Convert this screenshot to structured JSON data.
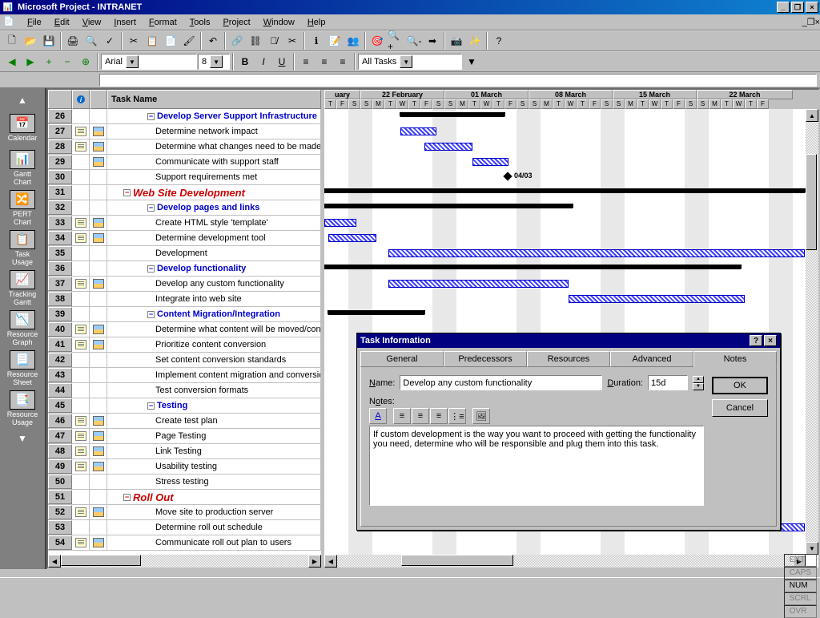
{
  "titlebar": {
    "app": "Microsoft Project",
    "doc": "INTRANET"
  },
  "menu": [
    "File",
    "Edit",
    "View",
    "Insert",
    "Format",
    "Tools",
    "Project",
    "Window",
    "Help"
  ],
  "toolbar2": {
    "font": "Arial",
    "size": "8",
    "filter": "All Tasks"
  },
  "viewbar": [
    {
      "label": "Calendar"
    },
    {
      "label": "Gantt Chart"
    },
    {
      "label": "PERT Chart"
    },
    {
      "label": "Task Usage"
    },
    {
      "label": "Tracking Gantt"
    },
    {
      "label": "Resource Graph"
    },
    {
      "label": "Resource Sheet"
    },
    {
      "label": "Resource Usage"
    }
  ],
  "grid": {
    "header": {
      "info": "i",
      "name": "Task Name"
    },
    "rows": [
      {
        "n": 26,
        "note": false,
        "ind": false,
        "lvl": 3,
        "bold": true,
        "text": "Develop Server Support Infrastructure",
        "out": "-"
      },
      {
        "n": 27,
        "note": true,
        "ind": true,
        "lvl": 4,
        "text": "Determine network impact"
      },
      {
        "n": 28,
        "note": true,
        "ind": true,
        "lvl": 4,
        "text": "Determine what changes need to be made"
      },
      {
        "n": 29,
        "note": false,
        "ind": true,
        "lvl": 4,
        "text": "Communicate with support staff"
      },
      {
        "n": 30,
        "note": false,
        "ind": false,
        "lvl": 4,
        "text": "Support requirements met"
      },
      {
        "n": 31,
        "note": false,
        "ind": false,
        "lvl": 2,
        "red": true,
        "text": "Web Site Development",
        "out": "-"
      },
      {
        "n": 32,
        "note": false,
        "ind": false,
        "lvl": 3,
        "bold": true,
        "text": "Develop pages and links",
        "out": "-"
      },
      {
        "n": 33,
        "note": true,
        "ind": true,
        "lvl": 4,
        "text": "Create HTML style 'template'"
      },
      {
        "n": 34,
        "note": true,
        "ind": true,
        "lvl": 4,
        "text": "Determine development tool"
      },
      {
        "n": 35,
        "note": false,
        "ind": false,
        "lvl": 4,
        "text": "Development"
      },
      {
        "n": 36,
        "note": false,
        "ind": false,
        "lvl": 3,
        "bold": true,
        "text": "Develop functionality",
        "out": "-"
      },
      {
        "n": 37,
        "note": true,
        "ind": true,
        "lvl": 4,
        "text": "Develop any custom functionality"
      },
      {
        "n": 38,
        "note": false,
        "ind": false,
        "lvl": 4,
        "text": "Integrate into web site"
      },
      {
        "n": 39,
        "note": false,
        "ind": false,
        "lvl": 3,
        "bold": true,
        "text": "Content Migration/Integration",
        "out": "-"
      },
      {
        "n": 40,
        "note": true,
        "ind": true,
        "lvl": 4,
        "text": "Determine what content will be moved/converted"
      },
      {
        "n": 41,
        "note": true,
        "ind": true,
        "lvl": 4,
        "text": "Prioritize content conversion"
      },
      {
        "n": 42,
        "note": false,
        "ind": false,
        "lvl": 4,
        "text": "Set content conversion standards"
      },
      {
        "n": 43,
        "note": false,
        "ind": false,
        "lvl": 4,
        "text": "Implement content migration and conversion"
      },
      {
        "n": 44,
        "note": false,
        "ind": false,
        "lvl": 4,
        "text": "Test conversion formats"
      },
      {
        "n": 45,
        "note": false,
        "ind": false,
        "lvl": 3,
        "bold": true,
        "text": "Testing",
        "out": "-"
      },
      {
        "n": 46,
        "note": true,
        "ind": true,
        "lvl": 4,
        "text": "Create test plan"
      },
      {
        "n": 47,
        "note": true,
        "ind": true,
        "lvl": 4,
        "text": "Page Testing"
      },
      {
        "n": 48,
        "note": true,
        "ind": true,
        "lvl": 4,
        "text": "Link Testing"
      },
      {
        "n": 49,
        "note": true,
        "ind": true,
        "lvl": 4,
        "text": "Usability testing"
      },
      {
        "n": 50,
        "note": false,
        "ind": false,
        "lvl": 4,
        "text": "Stress testing"
      },
      {
        "n": 51,
        "note": false,
        "ind": false,
        "lvl": 2,
        "red": true,
        "text": "Roll Out",
        "out": "-"
      },
      {
        "n": 52,
        "note": true,
        "ind": true,
        "lvl": 4,
        "text": "Move site to production server"
      },
      {
        "n": 53,
        "note": false,
        "ind": false,
        "lvl": 4,
        "text": "Determine roll out schedule"
      },
      {
        "n": 54,
        "note": true,
        "ind": true,
        "lvl": 4,
        "text": "Communicate roll out plan to users"
      }
    ]
  },
  "timeline": {
    "weeks": [
      "uary",
      "22 February",
      "01 March",
      "08 March",
      "15 March",
      "22 March"
    ],
    "days": [
      "T",
      "F",
      "S",
      "S",
      "M",
      "T",
      "W",
      "T",
      "F",
      "S",
      "S",
      "M",
      "T",
      "W",
      "T",
      "F",
      "S",
      "S",
      "M",
      "T",
      "W",
      "T",
      "F",
      "S",
      "S",
      "M",
      "T",
      "W",
      "T",
      "F",
      "S",
      "S",
      "M",
      "T",
      "W",
      "T",
      "F"
    ],
    "milestone_label": "04/03"
  },
  "dialog": {
    "title": "Task Information",
    "tabs": [
      "General",
      "Predecessors",
      "Resources",
      "Advanced",
      "Notes"
    ],
    "active_tab": "Notes",
    "name_label": "Name:",
    "name_value": "Develop any custom functionality",
    "duration_label": "Duration:",
    "duration_value": "15d",
    "notes_label": "Notes:",
    "notes_text": "If custom development is the way you want to proceed with getting the functionality you need, determine who will be responsible and plug them into this task.",
    "ok": "OK",
    "cancel": "Cancel"
  },
  "status": {
    "panes": [
      "EXT",
      "CAPS",
      "NUM",
      "SCRL",
      "OVR"
    ],
    "active": "NUM"
  }
}
